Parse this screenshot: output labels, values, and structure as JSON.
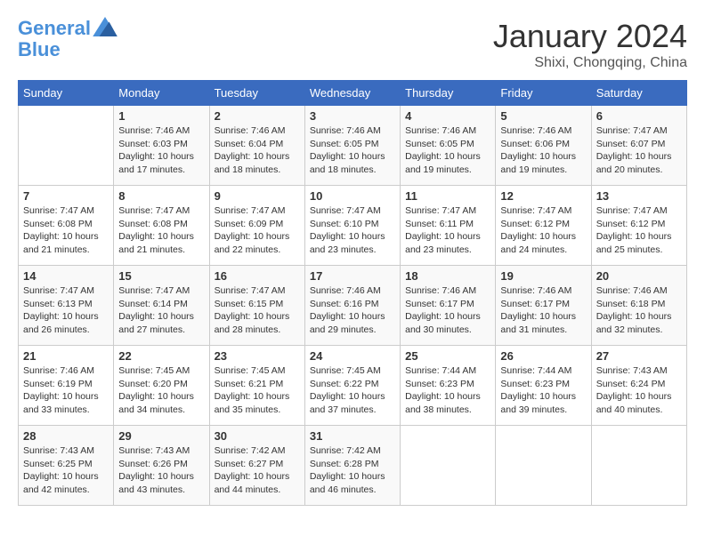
{
  "header": {
    "logo_line1": "General",
    "logo_line2": "Blue",
    "month": "January 2024",
    "location": "Shixi, Chongqing, China"
  },
  "weekdays": [
    "Sunday",
    "Monday",
    "Tuesday",
    "Wednesday",
    "Thursday",
    "Friday",
    "Saturday"
  ],
  "weeks": [
    [
      {
        "day": "",
        "sunrise": "",
        "sunset": "",
        "daylight": ""
      },
      {
        "day": "1",
        "sunrise": "Sunrise: 7:46 AM",
        "sunset": "Sunset: 6:03 PM",
        "daylight": "Daylight: 10 hours and 17 minutes."
      },
      {
        "day": "2",
        "sunrise": "Sunrise: 7:46 AM",
        "sunset": "Sunset: 6:04 PM",
        "daylight": "Daylight: 10 hours and 18 minutes."
      },
      {
        "day": "3",
        "sunrise": "Sunrise: 7:46 AM",
        "sunset": "Sunset: 6:05 PM",
        "daylight": "Daylight: 10 hours and 18 minutes."
      },
      {
        "day": "4",
        "sunrise": "Sunrise: 7:46 AM",
        "sunset": "Sunset: 6:05 PM",
        "daylight": "Daylight: 10 hours and 19 minutes."
      },
      {
        "day": "5",
        "sunrise": "Sunrise: 7:46 AM",
        "sunset": "Sunset: 6:06 PM",
        "daylight": "Daylight: 10 hours and 19 minutes."
      },
      {
        "day": "6",
        "sunrise": "Sunrise: 7:47 AM",
        "sunset": "Sunset: 6:07 PM",
        "daylight": "Daylight: 10 hours and 20 minutes."
      }
    ],
    [
      {
        "day": "7",
        "sunrise": "Sunrise: 7:47 AM",
        "sunset": "Sunset: 6:08 PM",
        "daylight": "Daylight: 10 hours and 21 minutes."
      },
      {
        "day": "8",
        "sunrise": "Sunrise: 7:47 AM",
        "sunset": "Sunset: 6:08 PM",
        "daylight": "Daylight: 10 hours and 21 minutes."
      },
      {
        "day": "9",
        "sunrise": "Sunrise: 7:47 AM",
        "sunset": "Sunset: 6:09 PM",
        "daylight": "Daylight: 10 hours and 22 minutes."
      },
      {
        "day": "10",
        "sunrise": "Sunrise: 7:47 AM",
        "sunset": "Sunset: 6:10 PM",
        "daylight": "Daylight: 10 hours and 23 minutes."
      },
      {
        "day": "11",
        "sunrise": "Sunrise: 7:47 AM",
        "sunset": "Sunset: 6:11 PM",
        "daylight": "Daylight: 10 hours and 23 minutes."
      },
      {
        "day": "12",
        "sunrise": "Sunrise: 7:47 AM",
        "sunset": "Sunset: 6:12 PM",
        "daylight": "Daylight: 10 hours and 24 minutes."
      },
      {
        "day": "13",
        "sunrise": "Sunrise: 7:47 AM",
        "sunset": "Sunset: 6:12 PM",
        "daylight": "Daylight: 10 hours and 25 minutes."
      }
    ],
    [
      {
        "day": "14",
        "sunrise": "Sunrise: 7:47 AM",
        "sunset": "Sunset: 6:13 PM",
        "daylight": "Daylight: 10 hours and 26 minutes."
      },
      {
        "day": "15",
        "sunrise": "Sunrise: 7:47 AM",
        "sunset": "Sunset: 6:14 PM",
        "daylight": "Daylight: 10 hours and 27 minutes."
      },
      {
        "day": "16",
        "sunrise": "Sunrise: 7:47 AM",
        "sunset": "Sunset: 6:15 PM",
        "daylight": "Daylight: 10 hours and 28 minutes."
      },
      {
        "day": "17",
        "sunrise": "Sunrise: 7:46 AM",
        "sunset": "Sunset: 6:16 PM",
        "daylight": "Daylight: 10 hours and 29 minutes."
      },
      {
        "day": "18",
        "sunrise": "Sunrise: 7:46 AM",
        "sunset": "Sunset: 6:17 PM",
        "daylight": "Daylight: 10 hours and 30 minutes."
      },
      {
        "day": "19",
        "sunrise": "Sunrise: 7:46 AM",
        "sunset": "Sunset: 6:17 PM",
        "daylight": "Daylight: 10 hours and 31 minutes."
      },
      {
        "day": "20",
        "sunrise": "Sunrise: 7:46 AM",
        "sunset": "Sunset: 6:18 PM",
        "daylight": "Daylight: 10 hours and 32 minutes."
      }
    ],
    [
      {
        "day": "21",
        "sunrise": "Sunrise: 7:46 AM",
        "sunset": "Sunset: 6:19 PM",
        "daylight": "Daylight: 10 hours and 33 minutes."
      },
      {
        "day": "22",
        "sunrise": "Sunrise: 7:45 AM",
        "sunset": "Sunset: 6:20 PM",
        "daylight": "Daylight: 10 hours and 34 minutes."
      },
      {
        "day": "23",
        "sunrise": "Sunrise: 7:45 AM",
        "sunset": "Sunset: 6:21 PM",
        "daylight": "Daylight: 10 hours and 35 minutes."
      },
      {
        "day": "24",
        "sunrise": "Sunrise: 7:45 AM",
        "sunset": "Sunset: 6:22 PM",
        "daylight": "Daylight: 10 hours and 37 minutes."
      },
      {
        "day": "25",
        "sunrise": "Sunrise: 7:44 AM",
        "sunset": "Sunset: 6:23 PM",
        "daylight": "Daylight: 10 hours and 38 minutes."
      },
      {
        "day": "26",
        "sunrise": "Sunrise: 7:44 AM",
        "sunset": "Sunset: 6:23 PM",
        "daylight": "Daylight: 10 hours and 39 minutes."
      },
      {
        "day": "27",
        "sunrise": "Sunrise: 7:43 AM",
        "sunset": "Sunset: 6:24 PM",
        "daylight": "Daylight: 10 hours and 40 minutes."
      }
    ],
    [
      {
        "day": "28",
        "sunrise": "Sunrise: 7:43 AM",
        "sunset": "Sunset: 6:25 PM",
        "daylight": "Daylight: 10 hours and 42 minutes."
      },
      {
        "day": "29",
        "sunrise": "Sunrise: 7:43 AM",
        "sunset": "Sunset: 6:26 PM",
        "daylight": "Daylight: 10 hours and 43 minutes."
      },
      {
        "day": "30",
        "sunrise": "Sunrise: 7:42 AM",
        "sunset": "Sunset: 6:27 PM",
        "daylight": "Daylight: 10 hours and 44 minutes."
      },
      {
        "day": "31",
        "sunrise": "Sunrise: 7:42 AM",
        "sunset": "Sunset: 6:28 PM",
        "daylight": "Daylight: 10 hours and 46 minutes."
      },
      {
        "day": "",
        "sunrise": "",
        "sunset": "",
        "daylight": ""
      },
      {
        "day": "",
        "sunrise": "",
        "sunset": "",
        "daylight": ""
      },
      {
        "day": "",
        "sunrise": "",
        "sunset": "",
        "daylight": ""
      }
    ]
  ]
}
